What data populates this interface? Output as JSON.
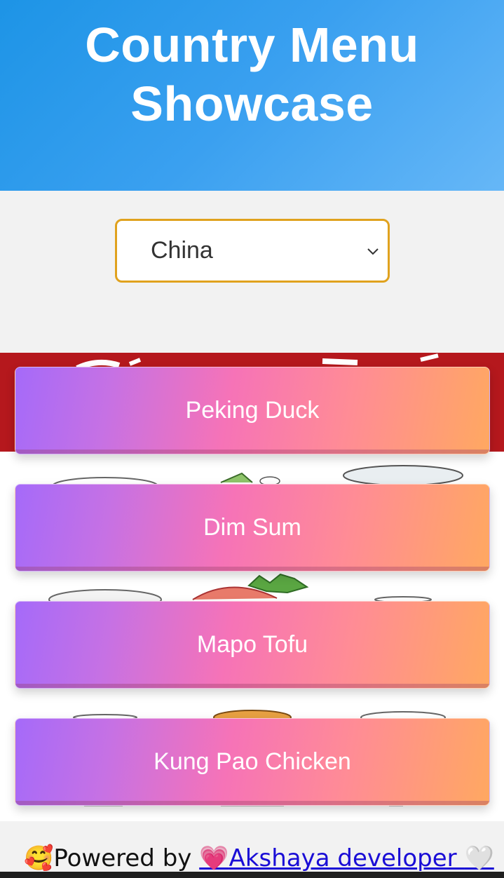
{
  "header": {
    "title": "Country Menu Showcase"
  },
  "country_select": {
    "selected": "China"
  },
  "dishes": [
    {
      "label": "Peking Duck"
    },
    {
      "label": "Dim Sum"
    },
    {
      "label": "Mapo Tofu"
    },
    {
      "label": "Kung Pao Chicken"
    }
  ],
  "footer": {
    "prefix_emoji": "🥰",
    "powered_by": "Powered by ",
    "heart_emoji": "💗",
    "link_text": "Akshaya developer ",
    "end_emoji": "🤍"
  },
  "colors": {
    "header_gradient_start": "#1d94e6",
    "header_gradient_end": "#66b7f7",
    "select_border": "#e0a21e",
    "banner_red": "#b5181d",
    "link": "#1a0dd6"
  }
}
